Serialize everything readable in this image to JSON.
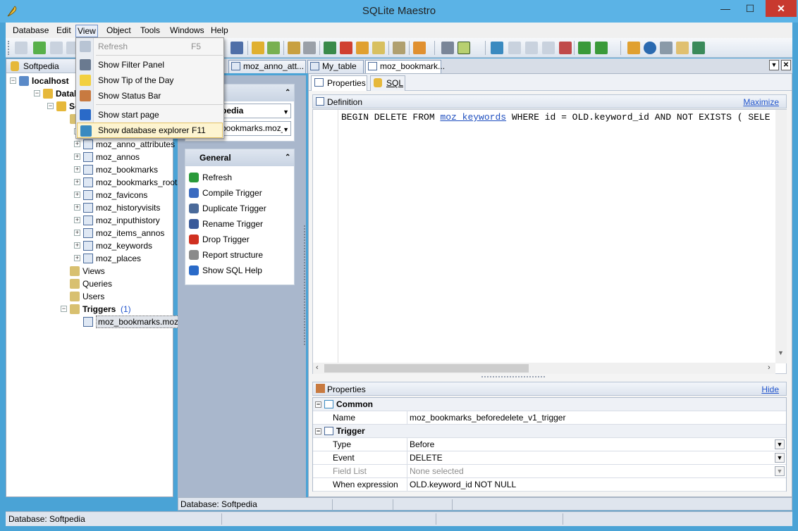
{
  "window": {
    "title": "SQLite Maestro",
    "close_glyph": "✕",
    "min_glyph": "—",
    "max_glyph": "☐"
  },
  "menubar": [
    "Database",
    "Edit",
    "View",
    "Object",
    "Tools",
    "Windows",
    "Help"
  ],
  "view_menu": {
    "items": [
      {
        "label": "Refresh",
        "shortcut": "F5",
        "icon": "refresh-icon",
        "disabled": true
      },
      {
        "label": "Show Filter Panel",
        "shortcut": "",
        "icon": "filter-icon"
      },
      {
        "label": "Show Tip of the Day",
        "shortcut": "",
        "icon": "lightbulb-icon"
      },
      {
        "label": "Show Status Bar",
        "shortcut": "",
        "icon": "statusbar-icon"
      },
      {
        "label": "Show start page",
        "shortcut": "",
        "icon": "start-page-icon"
      },
      {
        "label": "Show database explorer",
        "shortcut": "F11",
        "icon": "database-explorer-icon",
        "highlighted": true
      }
    ]
  },
  "explorer": {
    "header": "Softpedia",
    "tree": [
      {
        "label": "localhost",
        "level": 0
      },
      {
        "label": "Databa",
        "level": 1
      },
      {
        "label": "Sof",
        "level": 2
      },
      {
        "label": "",
        "level": 3
      },
      {
        "label": "",
        "level": 4
      },
      {
        "label": "moz_anno_attributes",
        "level": 4
      },
      {
        "label": "moz_annos",
        "level": 4
      },
      {
        "label": "moz_bookmarks",
        "level": 4
      },
      {
        "label": "moz_bookmarks_roots",
        "level": 4
      },
      {
        "label": "moz_favicons",
        "level": 4
      },
      {
        "label": "moz_historyvisits",
        "level": 4
      },
      {
        "label": "moz_inputhistory",
        "level": 4
      },
      {
        "label": "moz_items_annos",
        "level": 4
      },
      {
        "label": "moz_keywords",
        "level": 4
      },
      {
        "label": "moz_places",
        "level": 4
      },
      {
        "label": "Views",
        "level": 3
      },
      {
        "label": "Queries",
        "level": 3
      },
      {
        "label": "Users",
        "level": 3
      },
      {
        "label": "Triggers",
        "level": 3,
        "count": "(1)"
      },
      {
        "label": "moz_bookmarks.moz_bo",
        "level": 4
      }
    ]
  },
  "nav": {
    "combo1": "pedia",
    "combo2": "bookmarks.moz_",
    "general_title": "General",
    "links": [
      "Refresh",
      "Compile Trigger",
      "Duplicate Trigger",
      "Rename Trigger",
      "Drop Trigger",
      "Report structure",
      "Show SQL Help"
    ]
  },
  "tabs": [
    "moz_anno_att...",
    "My_table",
    "moz_bookmark..."
  ],
  "subtabs": [
    "Properties",
    "SQL"
  ],
  "definition": {
    "title": "Definition",
    "maximize": "Maximize",
    "sql_pre": "BEGIN DELETE FROM ",
    "sql_table": "moz_keywords",
    "sql_post": " WHERE id = OLD.keyword_id AND NOT EXISTS ( SELE"
  },
  "properties": {
    "title": "Properties",
    "hide": "Hide",
    "common": "Common",
    "trigger": "Trigger",
    "rows": [
      {
        "key": "Name",
        "value": "moz_bookmarks_beforedelete_v1_trigger",
        "dropdown": false
      },
      {
        "key": "Type",
        "value": "Before",
        "dropdown": true
      },
      {
        "key": "Event",
        "value": "DELETE",
        "dropdown": true
      },
      {
        "key": "Field List",
        "value": "None selected",
        "dropdown": true,
        "disabled": true
      },
      {
        "key": "When expression",
        "value": "OLD.keyword_id NOT NULL",
        "dropdown": false
      }
    ]
  },
  "status": {
    "inner": "Database: Softpedia",
    "outer": "Database: Softpedia"
  },
  "colors": {
    "titlebar": "#5bb3e6",
    "close": "#c8392f",
    "accent": "#3a78c4"
  }
}
